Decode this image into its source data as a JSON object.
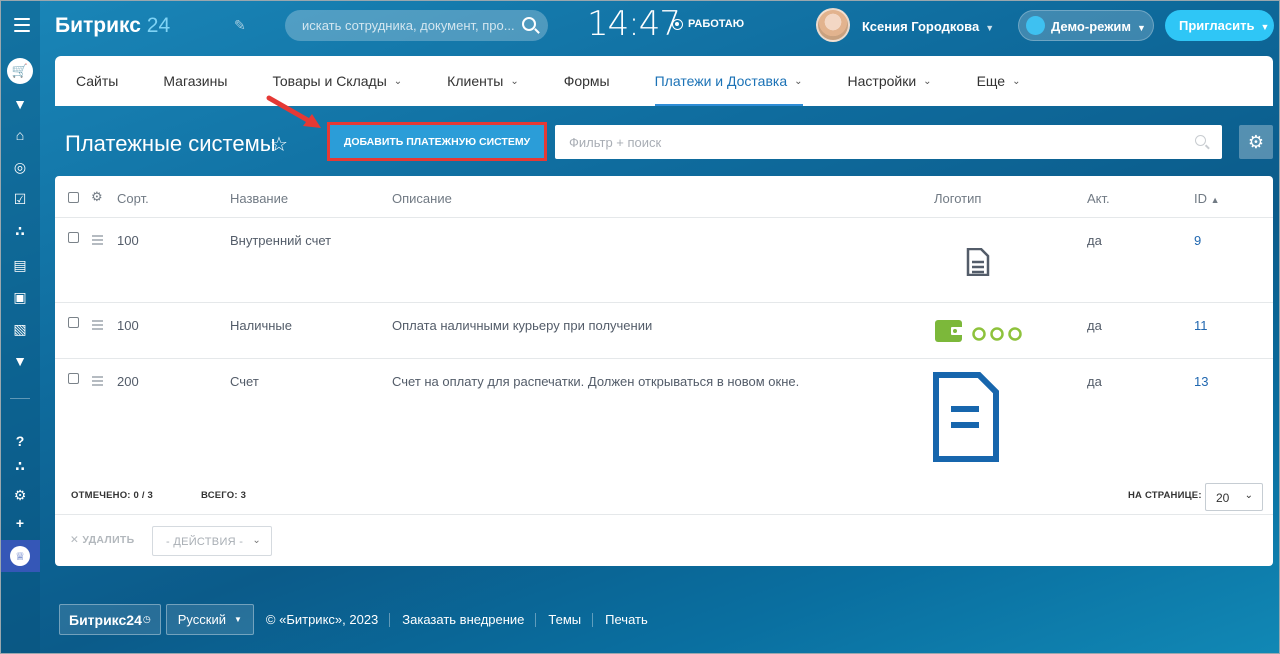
{
  "header": {
    "logo_main": "Битрикс",
    "logo_num": "24",
    "search_placeholder": "искать сотрудника, документ, про...",
    "time": "14:47",
    "status": "РАБОТАЮ",
    "user_name": "Ксения Городкова",
    "demo_label": "Демо-режим",
    "invite_label": "Пригласить"
  },
  "topnav": {
    "items": [
      {
        "label": "Сайты",
        "dropdown": false
      },
      {
        "label": "Магазины",
        "dropdown": false
      },
      {
        "label": "Товары и Склады",
        "dropdown": true
      },
      {
        "label": "Клиенты",
        "dropdown": true
      },
      {
        "label": "Формы",
        "dropdown": false
      },
      {
        "label": "Платежи и Доставка",
        "dropdown": true,
        "active": true
      },
      {
        "label": "Настройки",
        "dropdown": true
      },
      {
        "label": "Еще",
        "dropdown": true
      }
    ]
  },
  "page": {
    "title": "Платежные системы",
    "add_button": "ДОБАВИТЬ ПЛАТЕЖНУЮ СИСТЕМУ",
    "filter_placeholder": "Фильтр + поиск"
  },
  "table": {
    "columns": {
      "sort": "Сорт.",
      "name": "Название",
      "description": "Описание",
      "logo": "Логотип",
      "active": "Акт.",
      "id": "ID"
    },
    "rows": [
      {
        "sort": "100",
        "name": "Внутренний счет",
        "description": "",
        "logo_icon": "document-icon",
        "active": "да",
        "id": "9"
      },
      {
        "sort": "100",
        "name": "Наличные",
        "description": "Оплата наличными курьеру при получении",
        "logo_icon": "wallet-coins-icon",
        "active": "да",
        "id": "11"
      },
      {
        "sort": "200",
        "name": "Счет",
        "description": "Счет на оплату для распечатки. Должен открываться в новом окне.",
        "logo_icon": "invoice-icon",
        "active": "да",
        "id": "13"
      }
    ],
    "selected_label": "ОТМЕЧЕНО:",
    "selected_value": "0 / 3",
    "total_label": "ВСЕГО:",
    "total_value": "3",
    "per_page_label": "НА СТРАНИЦЕ:",
    "per_page_value": "20",
    "delete_label": "УДАЛИТЬ",
    "actions_label": "- ДЕЙСТВИЯ -"
  },
  "footer": {
    "brand": "Битрикс24",
    "language": "Русский",
    "copyright": "© «Битрикс», 2023",
    "links": [
      "Заказать внедрение",
      "Темы",
      "Печать"
    ]
  },
  "colors": {
    "accent": "#2b9dd8",
    "highlight": "#e53935",
    "link": "#2067b0",
    "active_nav": "#1b72b6"
  }
}
